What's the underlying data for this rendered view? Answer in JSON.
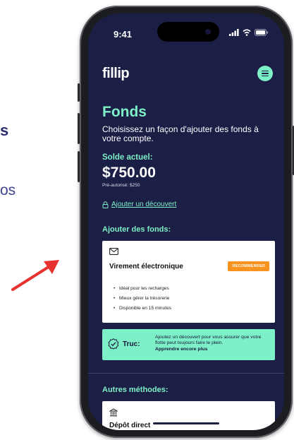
{
  "background": {
    "heading_fragment": "s",
    "text_fragment": "os"
  },
  "status_bar": {
    "time": "9:41"
  },
  "app": {
    "logo": "fillip",
    "title": "Fonds",
    "subtitle": "Choisissez un façon d'ajouter des fonds à votre compte.",
    "balance_label": "Solde actuel:",
    "balance_value": "$750.00",
    "preauthorized": "Pré-autorisé: $250",
    "overdraft_link": "Ajouter un découvert",
    "add_funds_label": "Ajouter des fonds:",
    "transfer_card": {
      "title": "Virement électronique",
      "badge": "RECOMMENDED",
      "items": [
        "Idéal pour les recharges",
        "Mieux gérer la trésorerie",
        "Disponible en 15 minutes"
      ]
    },
    "tip": {
      "label": "Truc:",
      "text": "Ajoutez un découvert pour vous assurer que votre flotte peut toujours faire le plein.",
      "link": "Apprendre encore plus"
    },
    "other_methods_label": "Autres méthodes:",
    "direct_deposit_card": {
      "title": "Dépôt direct"
    }
  },
  "colors": {
    "screen_bg": "#1b1e45",
    "accent": "#7ef0c7",
    "badge": "#f7931e",
    "arrow": "#e8322f"
  },
  "icons": [
    "wifi-icon",
    "cellular-icon",
    "battery-icon",
    "menu-icon",
    "lock-icon",
    "mail-icon",
    "check-badge-icon",
    "bank-icon",
    "arrow-icon"
  ]
}
